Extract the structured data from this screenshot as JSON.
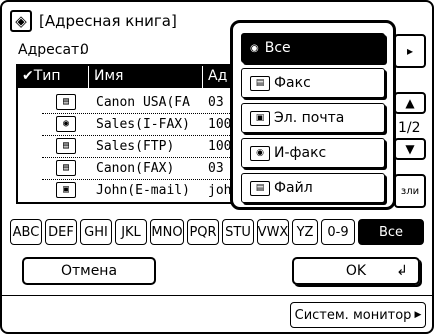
{
  "header": {
    "title": "[Адресная книга]",
    "icon": "address-book-icon"
  },
  "destination": {
    "label": "Адресат:",
    "count": "0"
  },
  "table": {
    "columns": [
      {
        "label": "Тип"
      },
      {
        "label": "Имя"
      },
      {
        "label": "Ад"
      }
    ],
    "rows": [
      {
        "type_icon": "fax-icon",
        "name": "Canon USA(FA",
        "address": "03"
      },
      {
        "type_icon": "i-fax-icon",
        "name": "Sales(I-FAX)",
        "address": "100"
      },
      {
        "type_icon": "file-icon",
        "name": "Sales(FTP)",
        "address": "100"
      },
      {
        "type_icon": "fax-icon",
        "name": "Canon(FAX)",
        "address": "03"
      },
      {
        "type_icon": "email-icon",
        "name": "John(E-mail)",
        "address": "joh"
      }
    ]
  },
  "pager": {
    "page": "1/2"
  },
  "side": {
    "mail_label": "зли"
  },
  "letters": [
    "ABC",
    "DEF",
    "GHI",
    "JKL",
    "MNO",
    "PQR",
    "STU",
    "VWX",
    "YZ",
    "0-9",
    "Все"
  ],
  "selected_letter": "Все",
  "buttons": {
    "cancel": "Отмена",
    "ok": "OK",
    "monitor": "Систем. монитор"
  },
  "type_menu": {
    "items": [
      {
        "label": "Все",
        "icon": "all-icon",
        "selected": true
      },
      {
        "label": "Факс",
        "icon": "fax-icon"
      },
      {
        "label": "Эл. почта",
        "icon": "email-icon"
      },
      {
        "label": "И-факс",
        "icon": "i-fax-icon"
      },
      {
        "label": "Файл",
        "icon": "file-icon"
      }
    ]
  }
}
